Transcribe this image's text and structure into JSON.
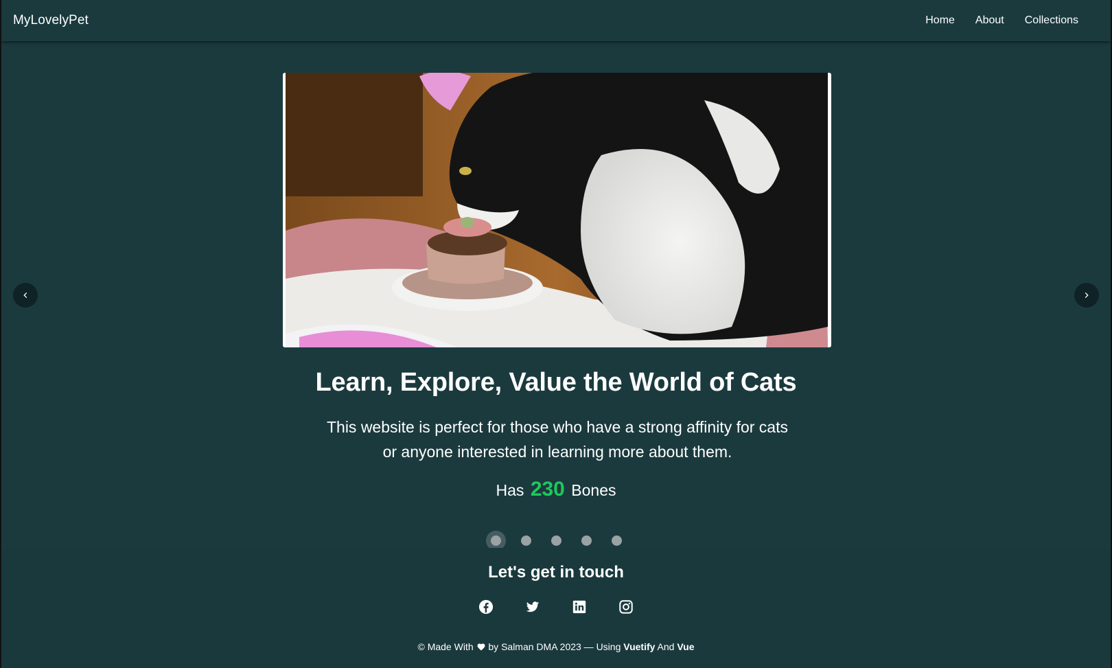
{
  "navbar": {
    "brand": "MyLovelyPet",
    "links": [
      {
        "label": "Home"
      },
      {
        "label": "About"
      },
      {
        "label": "Collections"
      }
    ]
  },
  "carousel": {
    "slide_image_icon": "cat-photo",
    "prev_icon": "chevron-left-icon",
    "next_icon": "chevron-right-icon",
    "headline": "Learn, Explore, Value the World of Cats",
    "description": "This website is perfect for those who have a strong affinity for cats or anyone interested in learning more about them.",
    "stat_prefix": "Has",
    "stat_value": "230",
    "stat_suffix": "Bones",
    "slide_count": 5,
    "active_slide": 1
  },
  "footer": {
    "title": "Let's get in touch",
    "socials": [
      "facebook-icon",
      "twitter-icon",
      "linkedin-icon",
      "instagram-icon"
    ],
    "credit_prefix": "© Made With",
    "credit_by": "by Salman DMA 2023 — Using",
    "credit_lib1": "Vuetify",
    "credit_and": "And",
    "credit_lib2": "Vue"
  },
  "colors": {
    "background": "#1b3a3e",
    "accent_number": "#1ec85a"
  }
}
